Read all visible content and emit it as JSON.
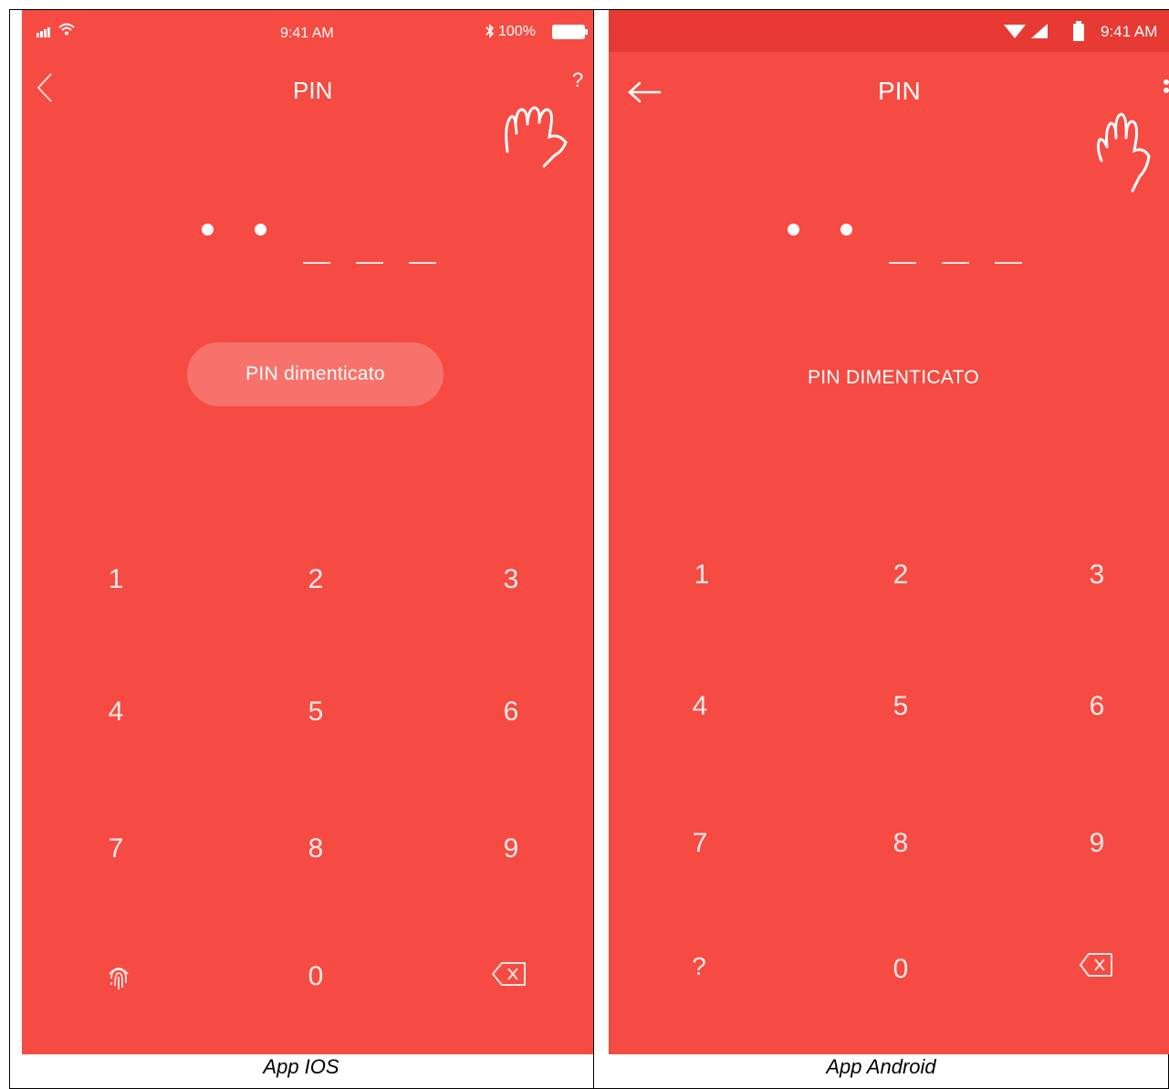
{
  "ios": {
    "status_time": "9:41 AM",
    "battery": "100%",
    "title": "PIN",
    "help": "?",
    "forgot": "PIN dimenticato",
    "keys": [
      "1",
      "2",
      "3",
      "4",
      "5",
      "6",
      "7",
      "8",
      "9",
      "0"
    ],
    "caption": "App IOS",
    "pin_filled": 2,
    "pin_length": 5
  },
  "android": {
    "status_time": "9:41 AM",
    "title": "PIN",
    "forgot": "PIN DIMENTICATO",
    "help_key": "?",
    "keys": [
      "1",
      "2",
      "3",
      "4",
      "5",
      "6",
      "7",
      "8",
      "9",
      "0"
    ],
    "caption": "App Android",
    "pin_filled": 2,
    "pin_length": 5
  },
  "colors": {
    "screen_bg": "#f64b43",
    "android_statusbar": "#e63a33",
    "text": "#ffffff"
  }
}
